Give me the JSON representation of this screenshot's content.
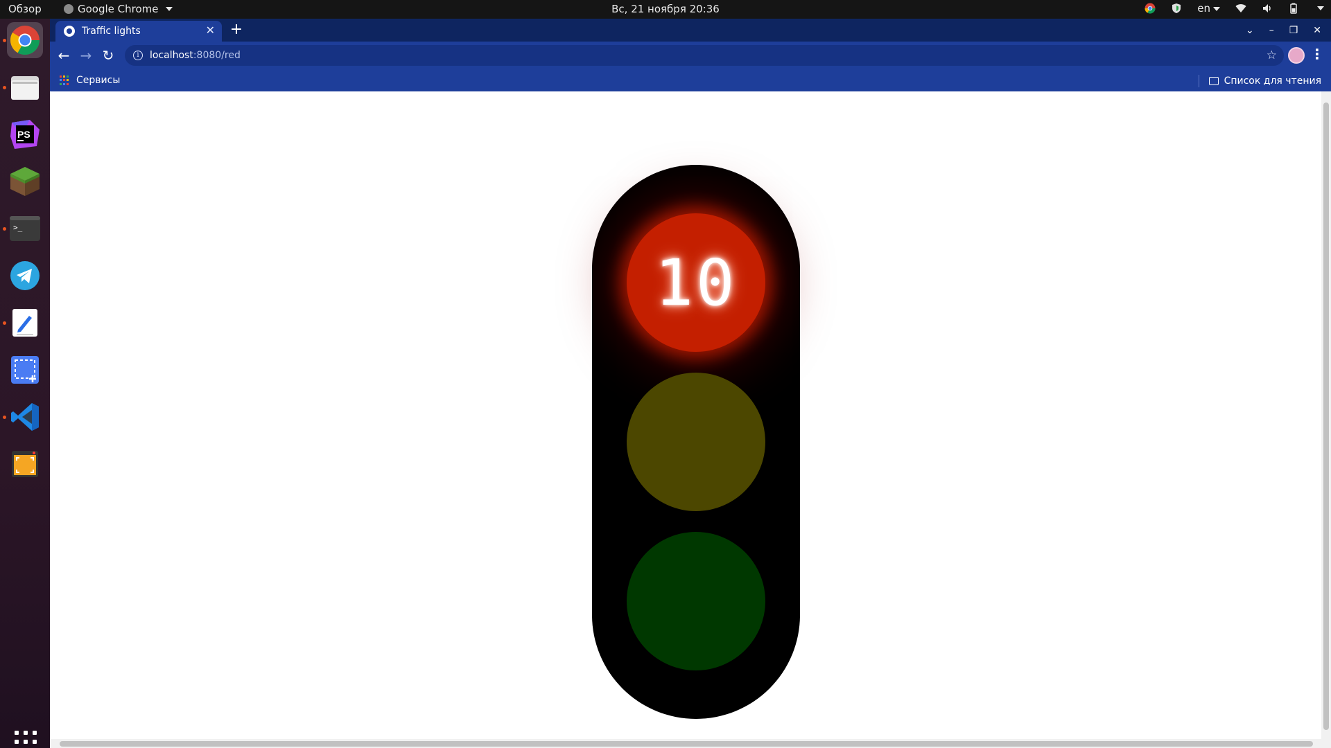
{
  "topbar": {
    "activities": "Обзор",
    "app_name": "Google Chrome",
    "clock": "Вс, 21 ноября  20:36",
    "keyboard_layout": "en"
  },
  "dock": {
    "items": [
      "chrome",
      "files",
      "phpstorm",
      "minecraft",
      "terminal",
      "telegram",
      "text-editor",
      "screenshot",
      "vscode",
      "screen-recorder"
    ]
  },
  "browser": {
    "tab_title": "Traffic lights",
    "url_host": "localhost",
    "url_rest": ":8080/red",
    "bookmarks": {
      "apps_label": "Сервисы",
      "reading_list_label": "Список для чтения"
    }
  },
  "traffic_light": {
    "active_lamp": "red",
    "countdown": "10",
    "colors": {
      "housing": "#000000",
      "red_on": "#c41f00",
      "yellow_off": "#4c4700",
      "green_off": "#003800"
    }
  },
  "colors": {
    "chrome_tabstrip": "#0e2560",
    "chrome_toolbar": "#1e3e9a",
    "dock_accent": "#e95420"
  }
}
